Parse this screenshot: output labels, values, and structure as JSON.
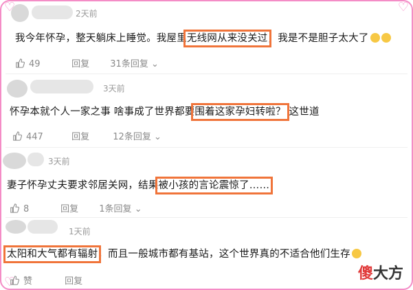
{
  "comments": [
    {
      "time": "2天前",
      "text_a": "我今年怀孕，整天躺床上睡觉。我屋里",
      "text_hl": "无线网从来没关过",
      "text_b": "，我是不是胆子太大了",
      "likes": "49",
      "reply_label": "回复",
      "reply_count": "31条回复"
    },
    {
      "time": "3天前",
      "text_a": "怀孕本就个人一家之事 啥事成了世界都要",
      "text_hl": "围着这家孕妇转啦？",
      "text_b": "这世道",
      "likes": "447",
      "reply_label": "回复",
      "reply_count": "12条回复"
    },
    {
      "time": "3天前",
      "text_a": "妻子怀孕丈夫要求邻居关网，结果",
      "text_hl": "被小孩的言论震惊了……",
      "text_b": "",
      "likes": "8",
      "reply_label": "回复",
      "reply_count": "1条回复"
    },
    {
      "time": "1天前",
      "text_a": "",
      "text_hl": "太阳和大气都有辐射",
      "text_b": "，而且一般城市都有基站，这个世界真的不适合他们生存",
      "likes": "赞",
      "reply_label": "回复",
      "reply_count": ""
    }
  ],
  "watermark": {
    "part_a": "傻",
    "part_b": "大方"
  },
  "colors": {
    "highlight_box": "#f0743a",
    "frame": "#f48cc6",
    "muted_text": "#8a8a8a"
  },
  "icons": {
    "like": "thumbs-up-icon",
    "emoji": "grin-emoji-icon",
    "reply_arrow": "chevron-down-icon"
  }
}
